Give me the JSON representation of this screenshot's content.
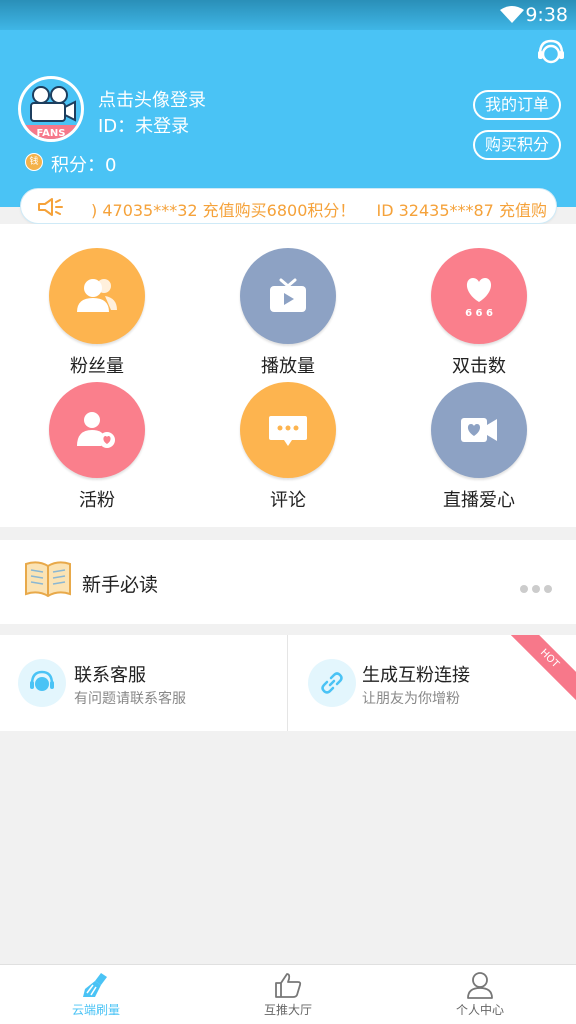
{
  "status": {
    "time": "9:38"
  },
  "header": {
    "login_prompt": "点击头像登录",
    "user_id": "ID：未登录",
    "points": "积分：0",
    "coin_char": "钱",
    "my_orders": "我的订单",
    "buy_points": "购买积分",
    "avatar_badge": "FANS"
  },
  "marquee": {
    "text": ") 47035***32 充值购买6800积分！　 ID 32435***87 充值购"
  },
  "features": [
    {
      "label": "粉丝量",
      "icon": "users-icon",
      "color": "#fdb44f"
    },
    {
      "label": "播放量",
      "icon": "tv-play-icon",
      "color": "#8da2c4"
    },
    {
      "label": "双击数",
      "icon": "heart-666-icon",
      "color": "#fa7f8c"
    },
    {
      "label": "活粉",
      "icon": "user-heart-icon",
      "color": "#fa7f8c"
    },
    {
      "label": "评论",
      "icon": "comment-icon",
      "color": "#fdb44f"
    },
    {
      "label": "直播爱心",
      "icon": "video-heart-icon",
      "color": "#8da2c4"
    }
  ],
  "newbie": {
    "label": "新手必读"
  },
  "services": {
    "contact": {
      "title": "联系客服",
      "subtitle": "有问题请联系客服"
    },
    "link": {
      "title": "生成互粉连接",
      "subtitle": "让朋友为你增粉",
      "badge": "HOT"
    }
  },
  "nav": [
    {
      "label": "云端刷量",
      "icon": "broom-icon",
      "active": true
    },
    {
      "label": "互推大厅",
      "icon": "thumbs-up-icon",
      "active": false
    },
    {
      "label": "个人中心",
      "icon": "person-icon",
      "active": false
    }
  ],
  "colors": {
    "primary": "#4ac3f5",
    "orange": "#fdb44f",
    "gray": "#8da2c4",
    "pink": "#fa7f8c",
    "marquee_text": "#f5a23a"
  }
}
